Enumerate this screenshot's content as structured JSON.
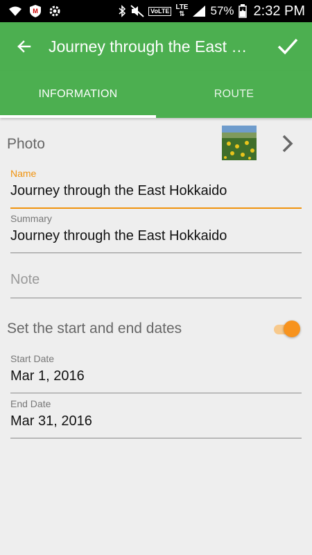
{
  "status_bar": {
    "battery": "57%",
    "time": "2:32 PM",
    "network": "LTE",
    "volte": "VoLTE",
    "icons": [
      "wifi-icon",
      "mcafee-icon",
      "settings-icon",
      "bluetooth-icon",
      "mute-icon",
      "signal-icon",
      "battery-icon"
    ]
  },
  "toolbar": {
    "title": "Journey through the East Hokkaido",
    "back_icon": "arrow-left-icon",
    "confirm_icon": "check-icon"
  },
  "tabs": [
    {
      "label": "INFORMATION",
      "active": true
    },
    {
      "label": "ROUTE",
      "active": false
    }
  ],
  "form": {
    "photo_label": "Photo",
    "name": {
      "label": "Name",
      "value": "Journey through the East Hokkaido"
    },
    "summary": {
      "label": "Summary",
      "value": "Journey through the East Hokkaido"
    },
    "note": {
      "placeholder": "Note"
    },
    "dates_toggle": {
      "label": "Set the start and end dates",
      "on": true
    },
    "start_date": {
      "label": "Start Date",
      "value": "Mar 1, 2016"
    },
    "end_date": {
      "label": "End Date",
      "value": "Mar 31, 2016"
    }
  },
  "colors": {
    "primary": "#4caf50",
    "accent": "#f7931e",
    "background": "#eeeeee"
  }
}
